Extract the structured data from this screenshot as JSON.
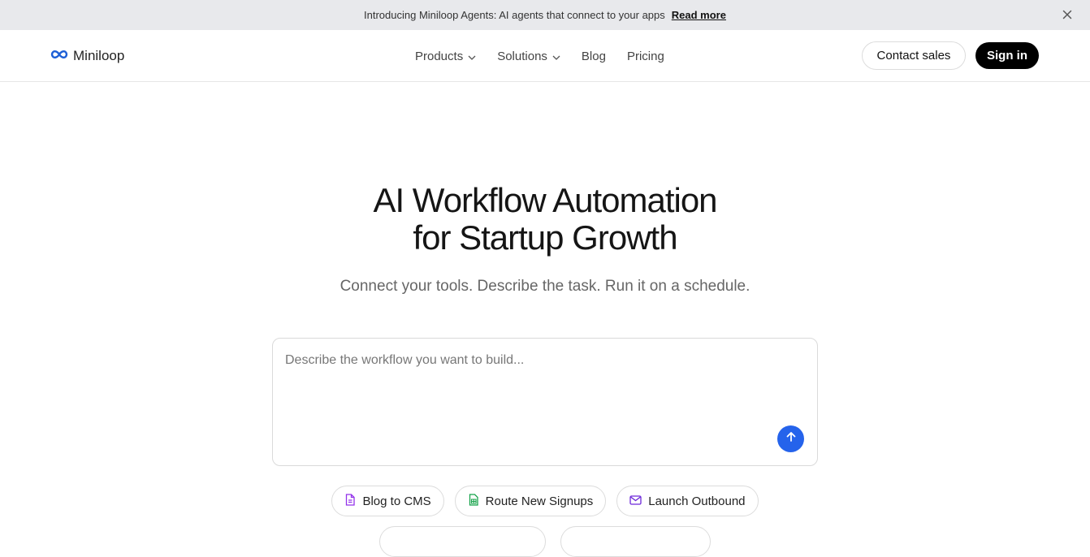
{
  "announcement": {
    "text": "Introducing Miniloop Agents: AI agents that connect to your apps",
    "link_label": "Read more",
    "close_icon": "close-icon"
  },
  "nav": {
    "brand": "Miniloop",
    "brand_icon": "infinity-logo-icon",
    "menu": [
      {
        "label": "Products",
        "has_dropdown": true
      },
      {
        "label": "Solutions",
        "has_dropdown": true
      },
      {
        "label": "Blog",
        "has_dropdown": false
      },
      {
        "label": "Pricing",
        "has_dropdown": false
      }
    ],
    "contact_label": "Contact sales",
    "signin_label": "Sign in"
  },
  "hero": {
    "title_line1": "AI Workflow Automation",
    "title_line2": "for Startup Growth",
    "subtitle": "Connect your tools. Describe the task. Run it on a schedule."
  },
  "prompt": {
    "placeholder": "Describe the workflow you want to build...",
    "value": "",
    "send_icon": "arrow-up-icon"
  },
  "suggestions": [
    {
      "label": "Blog to CMS",
      "icon": "document-icon",
      "color": "#9333ea"
    },
    {
      "label": "Route New Signups",
      "icon": "spreadsheet-icon",
      "color": "#16a34a"
    },
    {
      "label": "Launch Outbound",
      "icon": "mail-icon",
      "color": "#6d28d9"
    }
  ],
  "colors": {
    "accent": "#2563eb",
    "banner_bg": "#e8e9ec",
    "primary_button": "#000000"
  }
}
